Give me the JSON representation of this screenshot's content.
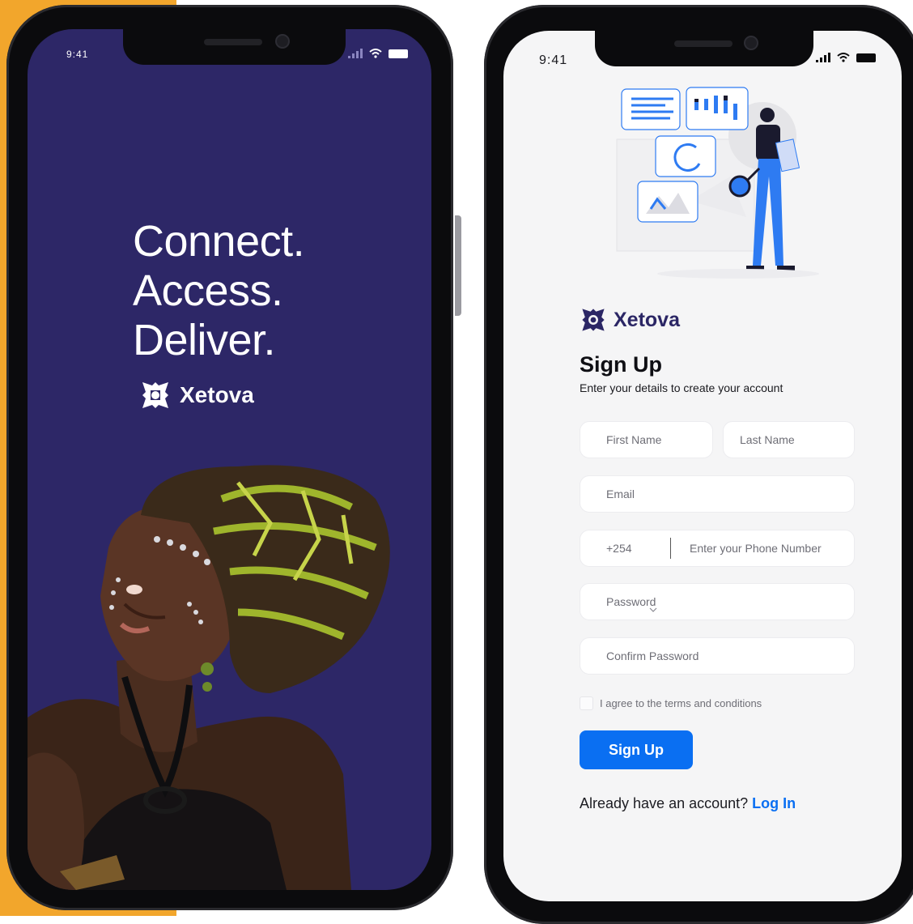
{
  "left_screen": {
    "status_time": "9:41",
    "tagline": [
      "Connect.",
      "Access.",
      "Deliver."
    ],
    "brand_name": "Xetova"
  },
  "right_screen": {
    "status_time": "9:41",
    "brand_name": "Xetova",
    "title": "Sign Up",
    "subtitle": "Enter your details to create your account",
    "fields": {
      "first_name": "First Name",
      "last_name": "Last Name",
      "email": "Email",
      "phone_code": "+254",
      "phone_number": "Enter your Phone Number",
      "password": "Password",
      "confirm_password": "Confirm Password"
    },
    "terms_label": "I agree to the terms and conditions",
    "signup_button": "Sign Up",
    "login_prompt": "Already have an account?",
    "login_link": "Log In"
  },
  "colors": {
    "accent_orange": "#f2a62c",
    "brand_indigo": "#2d2767",
    "primary_blue": "#0a6ff2"
  },
  "icons": [
    "xetova-logo-icon",
    "signal-icon",
    "wifi-icon",
    "battery-icon",
    "chevron-down-icon",
    "checkbox-icon"
  ]
}
